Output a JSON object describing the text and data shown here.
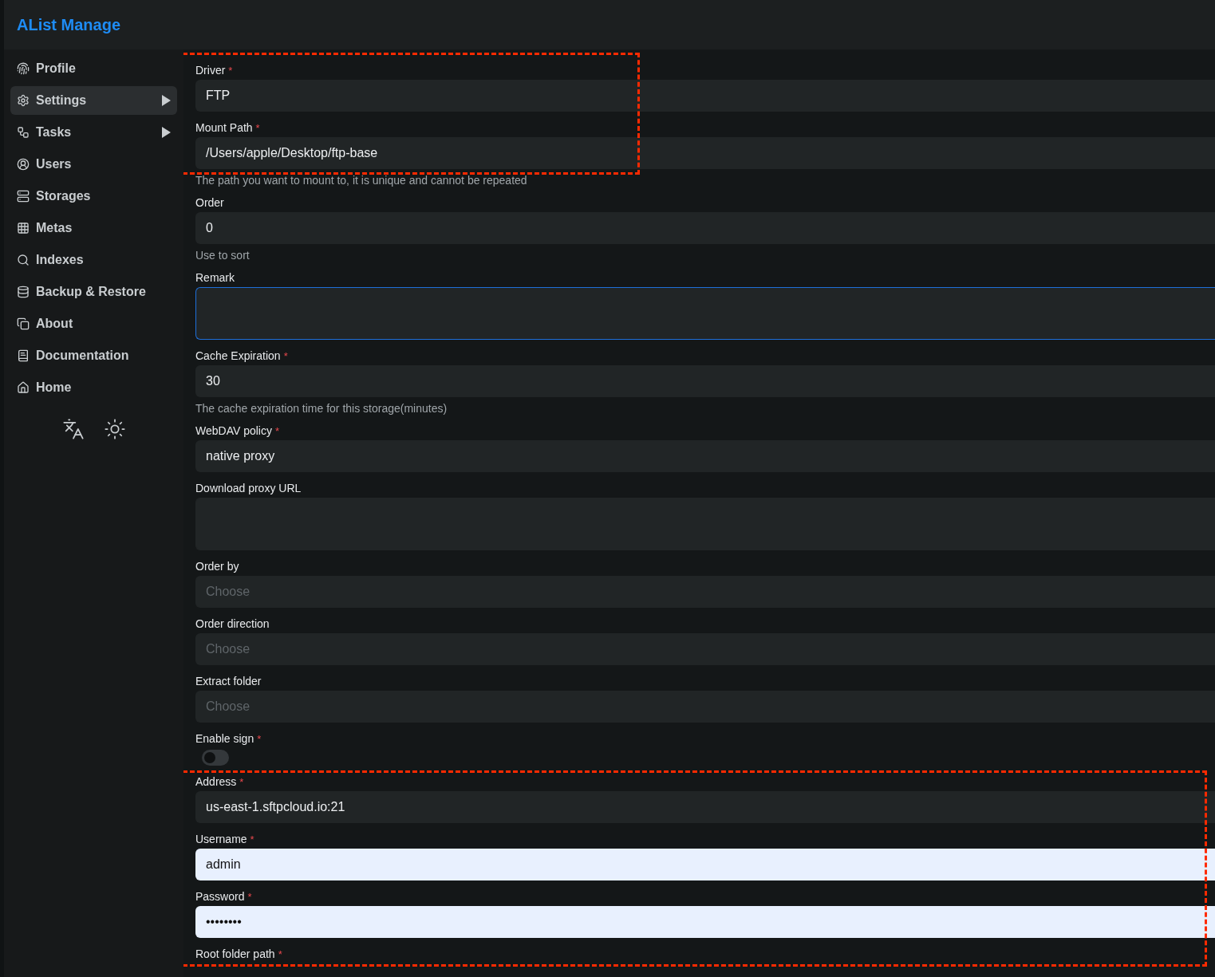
{
  "header": {
    "title": "AList Manage"
  },
  "sidebar": {
    "items": [
      {
        "label": "Profile",
        "selected": false,
        "has_submenu": false
      },
      {
        "label": "Settings",
        "selected": true,
        "has_submenu": true
      },
      {
        "label": "Tasks",
        "selected": false,
        "has_submenu": true
      },
      {
        "label": "Users",
        "selected": false,
        "has_submenu": false
      },
      {
        "label": "Storages",
        "selected": false,
        "has_submenu": false
      },
      {
        "label": "Metas",
        "selected": false,
        "has_submenu": false
      },
      {
        "label": "Indexes",
        "selected": false,
        "has_submenu": false
      },
      {
        "label": "Backup & Restore",
        "selected": false,
        "has_submenu": false
      },
      {
        "label": "About",
        "selected": false,
        "has_submenu": false
      },
      {
        "label": "Documentation",
        "selected": false,
        "has_submenu": false
      },
      {
        "label": "Home",
        "selected": false,
        "has_submenu": false
      }
    ]
  },
  "form": {
    "sections": [
      {
        "highlighted": true,
        "fields": [
          {
            "kind": "input",
            "label": "Driver",
            "required_mark": "*",
            "value": "FTP"
          },
          {
            "kind": "input",
            "label": "Mount Path",
            "required_mark": "*",
            "value": "/Users/apple/Desktop/ftp-base"
          }
        ]
      },
      {
        "fields": [
          {
            "kind": "help",
            "text": "The path you want to mount to, it is unique and cannot be repeated"
          },
          {
            "kind": "input",
            "label": "Order",
            "value": "0"
          },
          {
            "kind": "help",
            "text": "Use to sort"
          },
          {
            "kind": "textarea",
            "label": "Remark",
            "focused": true
          },
          {
            "kind": "input",
            "label": "Cache Expiration",
            "required_mark": "*",
            "value": "30"
          },
          {
            "kind": "help",
            "text": "The cache expiration time for this storage(minutes)"
          },
          {
            "kind": "input",
            "label": "WebDAV policy",
            "required_mark": "*",
            "value": "native proxy"
          },
          {
            "kind": "textarea",
            "label": "Download proxy URL",
            "focused": false
          },
          {
            "kind": "select",
            "label": "Order by",
            "placeholder": "Choose"
          },
          {
            "kind": "select",
            "label": "Order direction",
            "placeholder": "Choose"
          },
          {
            "kind": "select",
            "label": "Extract folder",
            "placeholder": "Choose"
          },
          {
            "kind": "switch",
            "label": "Enable sign",
            "required_mark": "*",
            "on": false
          }
        ]
      },
      {
        "highlighted": true,
        "fields": [
          {
            "kind": "input",
            "label": "Address",
            "required_mark": "*",
            "value": "us-east-1.sftpcloud.io:21"
          },
          {
            "kind": "input",
            "label": "Username",
            "required_mark": "*",
            "value": "admin",
            "autofilled": true
          },
          {
            "kind": "input",
            "label": "Password",
            "required_mark": "*",
            "value": "••••••••",
            "autofilled": true
          },
          {
            "kind": "label",
            "label": "Root folder path",
            "required_mark": "*"
          }
        ]
      }
    ]
  }
}
